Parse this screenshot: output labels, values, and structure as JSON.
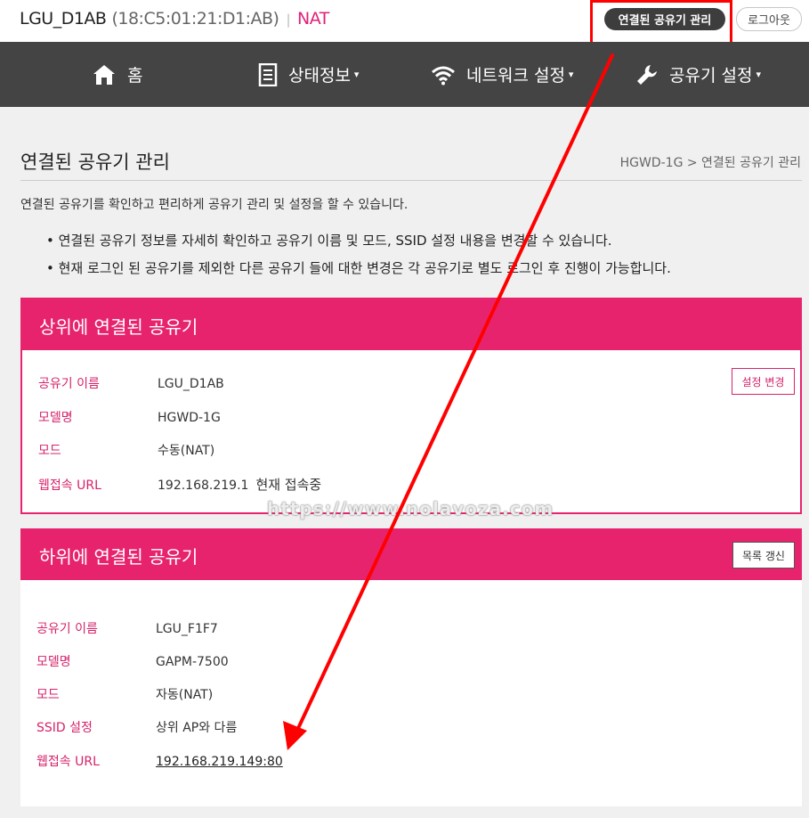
{
  "header": {
    "device_name": "LGU_D1AB",
    "mac": "(18:C5:01:21:D1:AB)",
    "separator": "|",
    "mode": "NAT",
    "manage_label": "연결된 공유기 관리",
    "logout_label": "로그아웃"
  },
  "nav": {
    "home": "홈",
    "status": "상태정보",
    "network": "네트워크 설정",
    "router": "공유기 설정",
    "caret": "▾"
  },
  "page": {
    "title": "연결된 공유기 관리",
    "breadcrumb": "HGWD-1G > 연결된 공유기 관리",
    "description": "연결된 공유기를 확인하고 편리하게 공유기 관리 및 설정을 할 수 있습니다.",
    "bullets": [
      "• 연결된 공유기 정보를 자세히 확인하고 공유기 이름 및 모드, SSID 설정 내용을 변경할 수 있습니다.",
      "• 현재 로그인 된 공유기를 제외한 다른 공유기 들에 대한 변경은 각 공유기로 별도 로그인 후 진행이 가능합니다."
    ]
  },
  "upper": {
    "title": "상위에 연결된 공유기",
    "button": "설정 변경",
    "rows": [
      {
        "key": "공유기 이름",
        "value": "LGU_D1AB"
      },
      {
        "key": "모델명",
        "value": "HGWD-1G"
      },
      {
        "key": "모드",
        "value": "수동(NAT)"
      },
      {
        "key": "웹접속 URL",
        "value": "192.168.219.1",
        "extra": "현재 접속중"
      }
    ]
  },
  "lower": {
    "title": "하위에 연결된 공유기",
    "button": "목록 갱신",
    "rows": [
      {
        "key": "공유기 이름",
        "value": "LGU_F1F7"
      },
      {
        "key": "모델명",
        "value": "GAPM-7500"
      },
      {
        "key": "모드",
        "value": "자동(NAT)"
      },
      {
        "key": "SSID 설정",
        "value": "상위 AP와 다름"
      },
      {
        "key": "웹접속 URL",
        "value": "192.168.219.149:80"
      }
    ]
  },
  "watermark": "https://www.nolavoza.com",
  "colors": {
    "accent": "#e8236e",
    "nav_bg": "#444444",
    "annotation": "#ff0000"
  }
}
